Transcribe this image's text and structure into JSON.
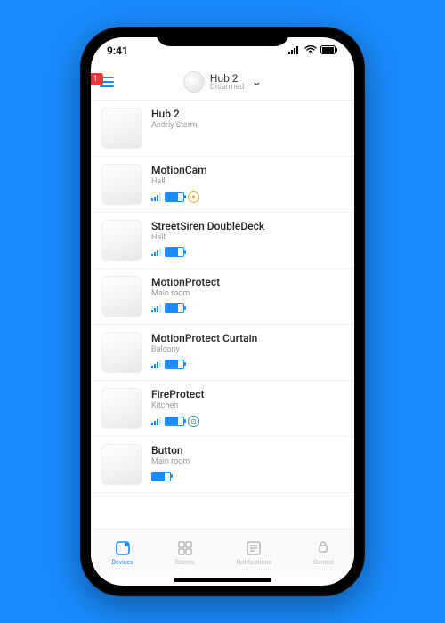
{
  "statusbar": {
    "time": "9:41"
  },
  "header": {
    "hub_name": "Hub 2",
    "hub_state": "Disarmed",
    "badge": "1"
  },
  "devices": [
    {
      "name": "Hub 2",
      "room": "Andriy Sterm",
      "signal": false,
      "battery": false,
      "extra": null
    },
    {
      "name": "MotionCam",
      "room": "Hall",
      "signal": true,
      "battery": true,
      "extra": "orange"
    },
    {
      "name": "StreetSiren DoubleDeck",
      "room": "Hall",
      "signal": true,
      "battery": true,
      "extra": null
    },
    {
      "name": "MotionProtect",
      "room": "Main room",
      "signal": true,
      "battery": true,
      "extra": null
    },
    {
      "name": "MotionProtect Curtain",
      "room": "Balcony",
      "signal": true,
      "battery": true,
      "extra": null
    },
    {
      "name": "FireProtect",
      "room": "Kitchen",
      "signal": true,
      "battery": true,
      "extra": "blue"
    },
    {
      "name": "Button",
      "room": "Main room",
      "signal": false,
      "battery": true,
      "extra": null
    }
  ],
  "tabs": [
    {
      "key": "devices",
      "label": "Devices",
      "active": true
    },
    {
      "key": "rooms",
      "label": "Rooms",
      "active": false
    },
    {
      "key": "notifs",
      "label": "Notifications",
      "active": false
    },
    {
      "key": "control",
      "label": "Control",
      "active": false
    }
  ]
}
